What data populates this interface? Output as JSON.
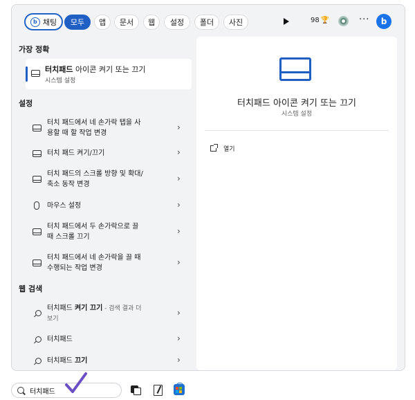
{
  "topbar": {
    "chat_label": "채팅",
    "filters": [
      {
        "label": "모두",
        "active": true
      },
      {
        "label": "앱",
        "active": false
      },
      {
        "label": "문서",
        "active": false
      },
      {
        "label": "웹",
        "active": false
      },
      {
        "label": "설정",
        "active": false
      },
      {
        "label": "폴더",
        "active": false
      },
      {
        "label": "사진",
        "active": false
      }
    ],
    "points": "98",
    "more": "···"
  },
  "best_match": {
    "heading": "가장 정확",
    "title_bold": "터치패드",
    "title_rest": " 아이콘 켜기 또는 끄기",
    "subtitle": "시스템 설정"
  },
  "settings": {
    "heading": "설정",
    "items": [
      {
        "line1": "터치 패드에서 네 손가락 탭을 사",
        "line2": "용할 때 할 작업 변경"
      },
      {
        "line1": "터치 패드 켜기/끄기",
        "line2": ""
      },
      {
        "line1": "터치 패드의 스크롤 방향 및 확대/",
        "line2": "축소 동작 변경"
      },
      {
        "line1": "마우스 설정",
        "line2": ""
      },
      {
        "line1": "터치 패드에서 두 손가락으로 끌",
        "line2": "때 스크롤 끄기"
      },
      {
        "line1": "터치 패드에서 네 손가락을 끌 때",
        "line2": "수행되는 작업 변경"
      }
    ]
  },
  "web": {
    "heading": "웹 검색",
    "items": [
      {
        "bold_prefix": "터치패드 ",
        "bold": "켜기 끄기",
        "suffix": " - 검색 결과 더",
        "line2": "보기"
      },
      {
        "bold_prefix": "터치패드",
        "bold": "",
        "suffix": "",
        "line2": ""
      },
      {
        "bold_prefix": "터치패드 ",
        "bold": "끄기",
        "suffix": "",
        "line2": ""
      }
    ]
  },
  "detail": {
    "title": "터치패드 아이콘 켜기 또는 끄기",
    "subtitle": "시스템 설정",
    "open_label": "열기"
  },
  "taskbar": {
    "search_value": "터치패드"
  },
  "colors": {
    "accent": "#1f5fc4",
    "check": "#6b4fc4"
  }
}
